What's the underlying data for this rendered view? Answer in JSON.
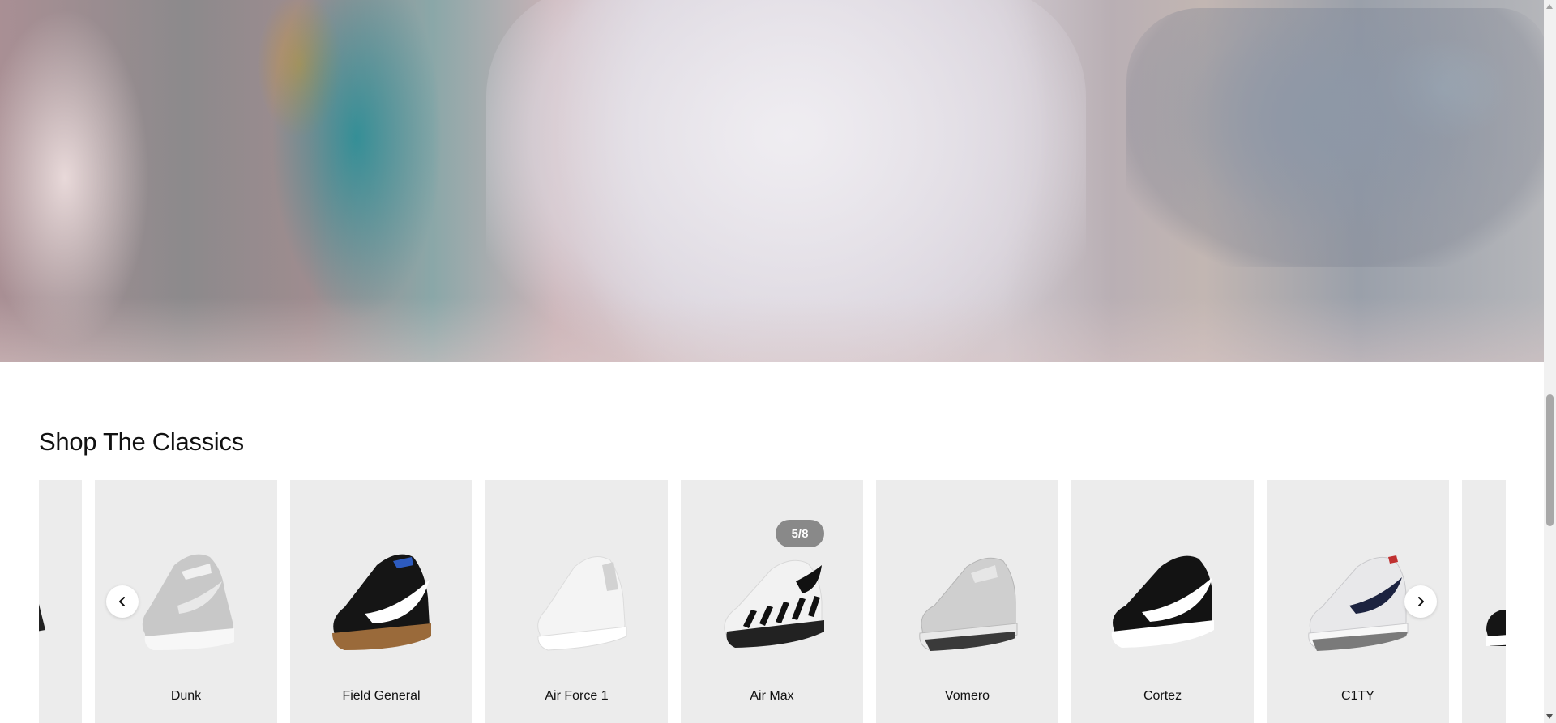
{
  "section": {
    "title": "Shop The Classics"
  },
  "carousel": {
    "counter": "5/8",
    "prev_icon": "chevron-left-icon",
    "next_icon": "chevron-right-icon",
    "items": [
      {
        "label": ""
      },
      {
        "label": "Dunk",
        "shoe_color": "#c8c8c8",
        "swoosh_color": "#e0e0e0"
      },
      {
        "label": "Field General",
        "shoe_color": "#151515",
        "swoosh_color": "#ffffff"
      },
      {
        "label": "Air Force 1",
        "shoe_color": "#f4f4f4",
        "swoosh_color": "#e6e6e6"
      },
      {
        "label": "Air Max",
        "shoe_color": "#f2f2f2",
        "swoosh_color": "#111111"
      },
      {
        "label": "Vomero",
        "shoe_color": "#cfcfcf",
        "swoosh_color": "#e6e6e6"
      },
      {
        "label": "Cortez",
        "shoe_color": "#131313",
        "swoosh_color": "#ffffff"
      },
      {
        "label": "C1TY",
        "shoe_color": "#e8e8ea",
        "swoosh_color": "#1c2340"
      },
      {
        "label": ""
      }
    ]
  }
}
